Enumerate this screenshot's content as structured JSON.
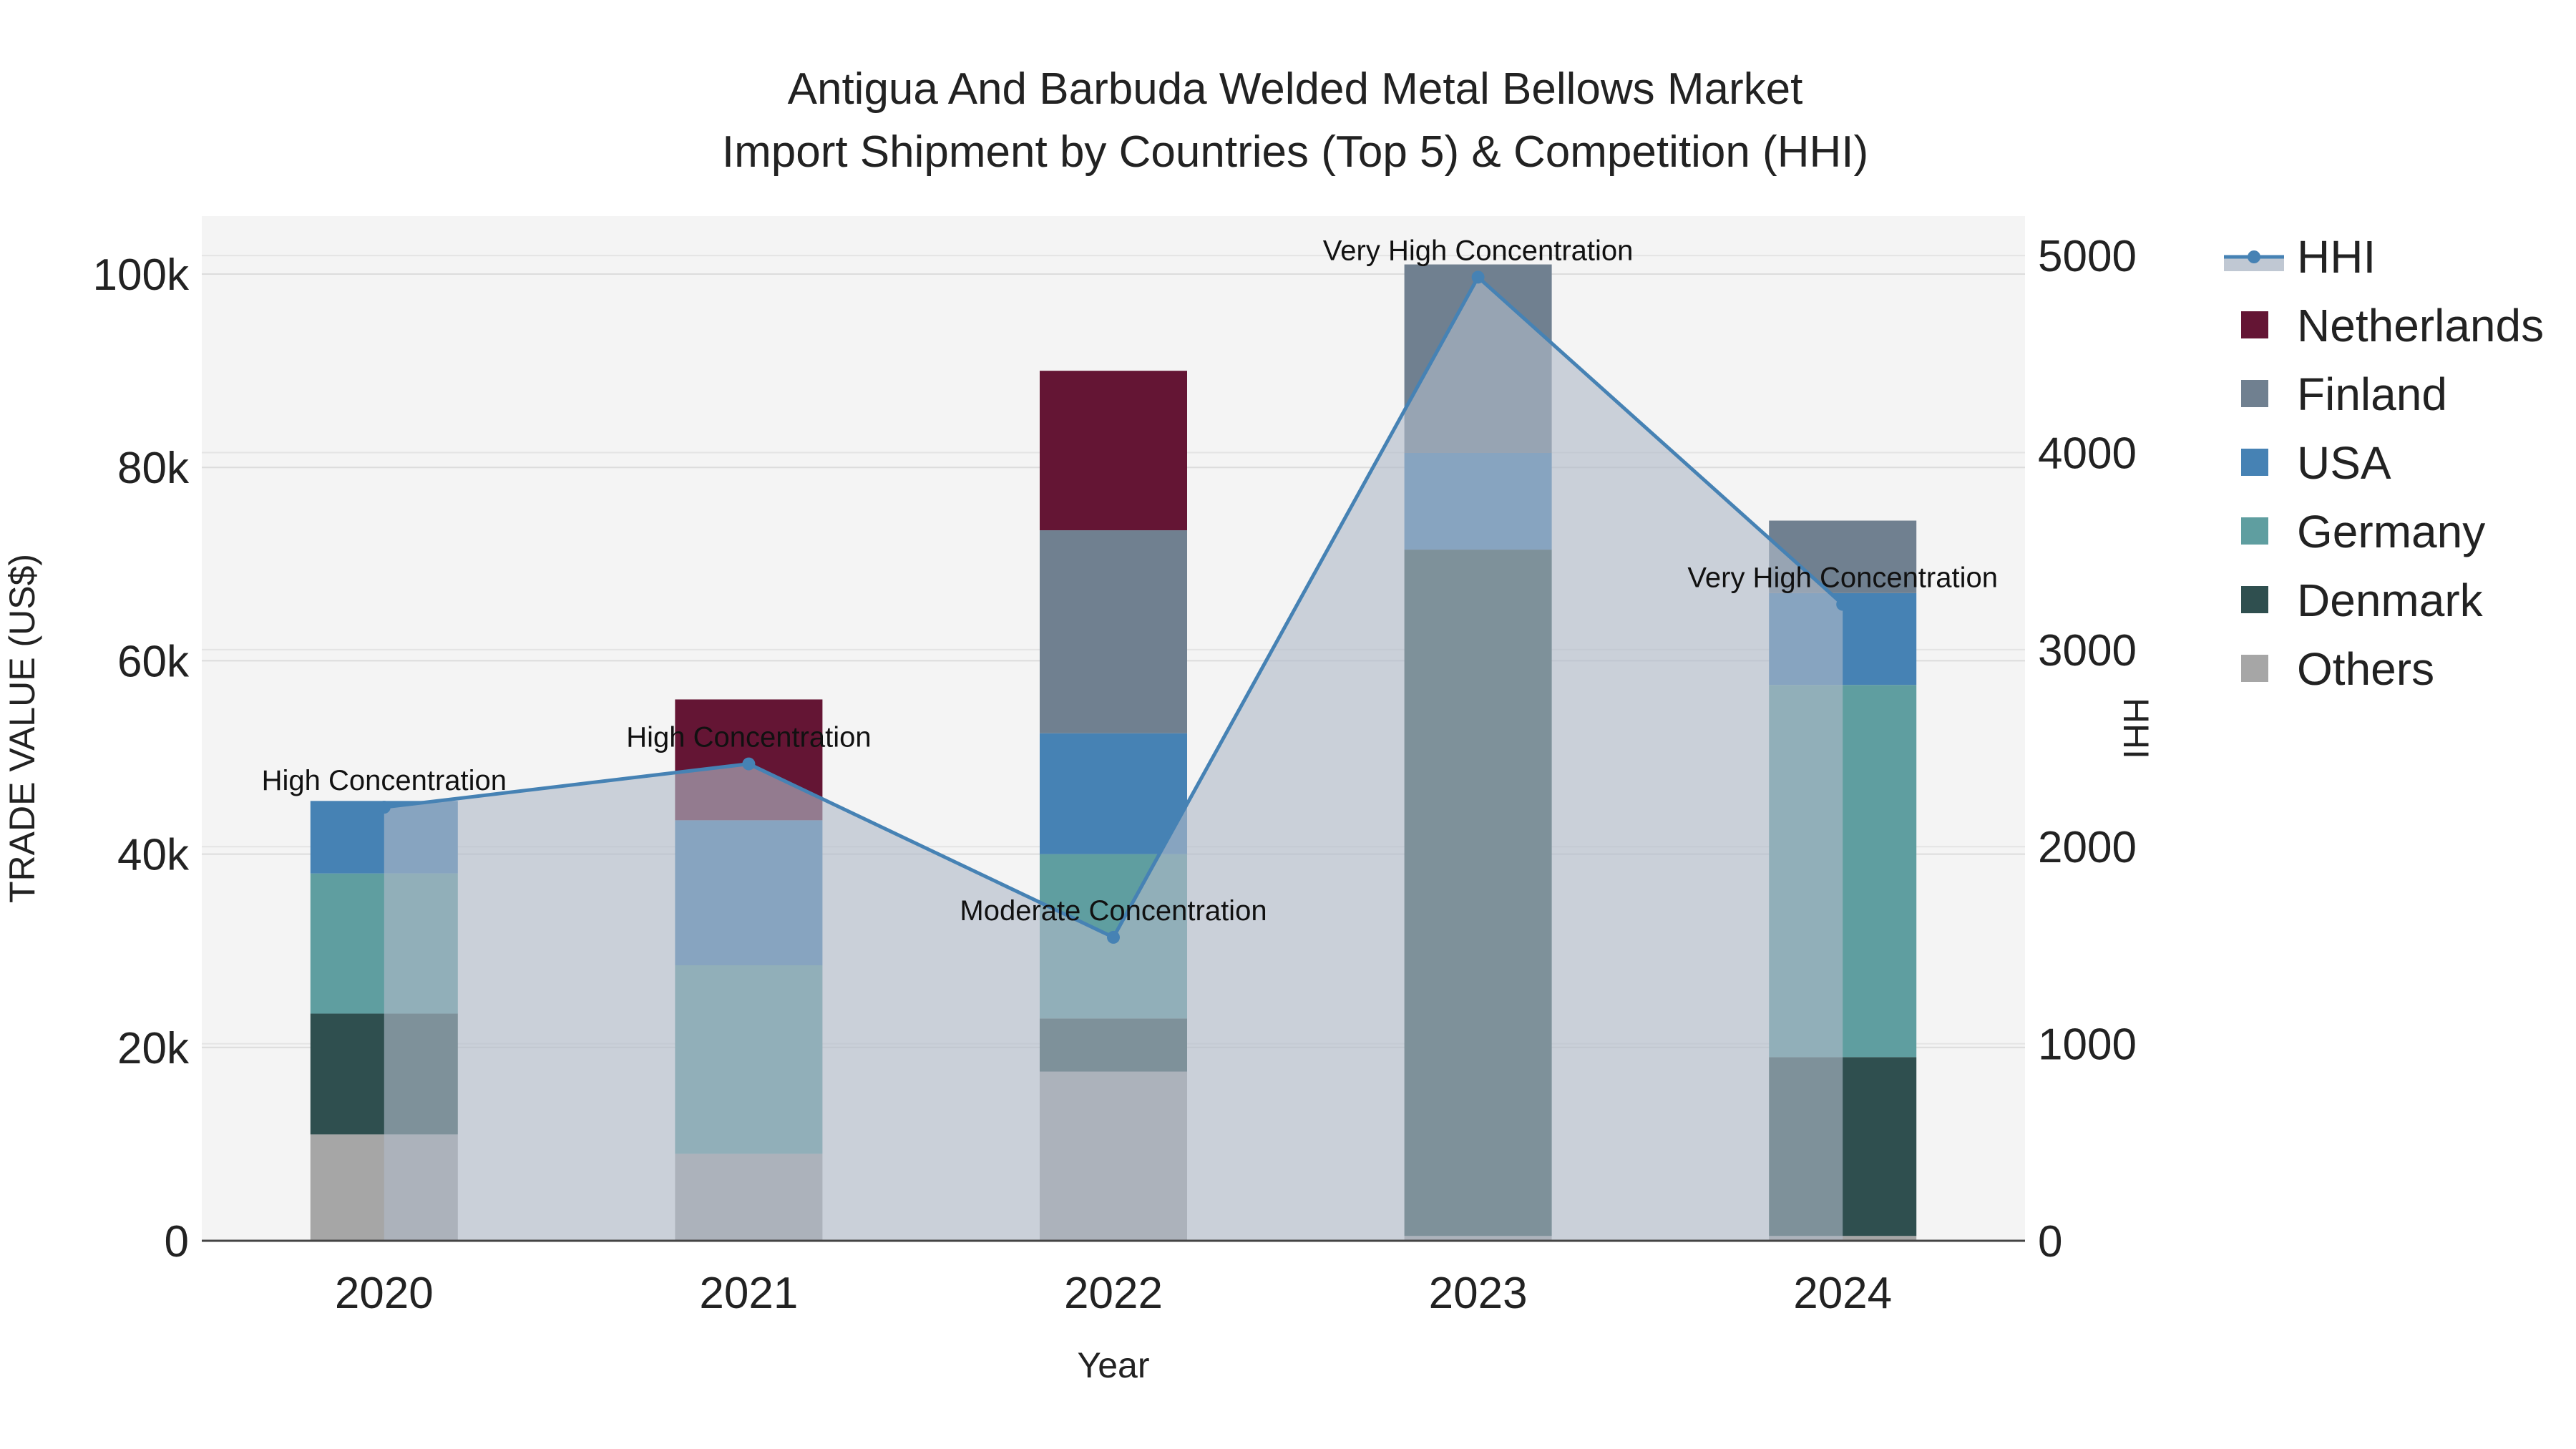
{
  "chart_data": {
    "type": "bar",
    "title": "Antigua And Barbuda Welded Metal Bellows Market",
    "subtitle": "Import Shipment by Countries (Top 5) & Competition (HHI)",
    "xlabel": "Year",
    "ylabel": "TRADE VALUE (US$)",
    "y2label": "HHI",
    "categories": [
      "2020",
      "2021",
      "2022",
      "2023",
      "2024"
    ],
    "ylim": [
      0,
      106000
    ],
    "y2lim": [
      0,
      5200
    ],
    "yticks": [
      0,
      20000,
      40000,
      60000,
      80000,
      100000
    ],
    "ytick_labels": [
      "0",
      "20k",
      "40k",
      "60k",
      "80k",
      "100k"
    ],
    "y2ticks": [
      0,
      1000,
      2000,
      3000,
      4000,
      5000
    ],
    "y2tick_labels": [
      "0",
      "1000",
      "2000",
      "3000",
      "4000",
      "5000"
    ],
    "grid": true,
    "legend_position": "right",
    "series": [
      {
        "name": "Others",
        "color": "#a6a6a6",
        "values": [
          11000,
          9000,
          17500,
          500,
          500
        ]
      },
      {
        "name": "Denmark",
        "color": "#2f4f4f",
        "values": [
          12500,
          0,
          5500,
          71000,
          18500
        ]
      },
      {
        "name": "Germany",
        "color": "#5f9ea0",
        "values": [
          14500,
          19500,
          17000,
          0,
          38500
        ]
      },
      {
        "name": "USA",
        "color": "#4682b4",
        "values": [
          7500,
          15000,
          12500,
          10000,
          9500
        ]
      },
      {
        "name": "Finland",
        "color": "#708090",
        "values": [
          0,
          0,
          21000,
          19500,
          7500
        ]
      },
      {
        "name": "Netherlands",
        "color": "#641534",
        "values": [
          0,
          12500,
          16500,
          0,
          0
        ]
      }
    ],
    "hhi": {
      "name": "HHI",
      "color": "#4682b4",
      "values": [
        2200,
        2420,
        1540,
        4890,
        3230
      ],
      "labels": [
        "High Concentration",
        "High Concentration",
        "Moderate Concentration",
        "Very High Concentration",
        "Very High Concentration"
      ]
    },
    "legend_order": [
      "HHI",
      "Netherlands",
      "Finland",
      "USA",
      "Germany",
      "Denmark",
      "Others"
    ]
  }
}
